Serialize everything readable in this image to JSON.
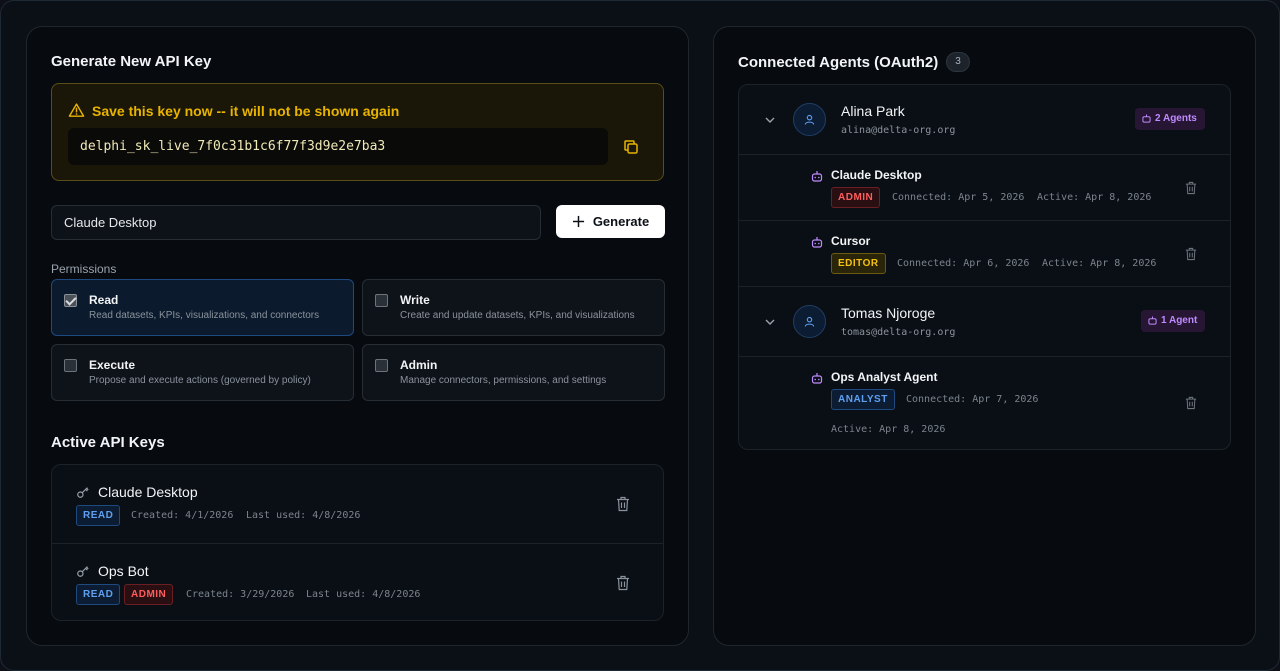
{
  "generate": {
    "title": "Generate New API Key",
    "warning": "Save this key now -- it will not be shown again",
    "key_value": "delphi_sk_live_7f0c31b1c6f77f3d9e2e7ba3",
    "name_input_value": "Claude Desktop",
    "generate_label": "Generate",
    "permissions_label": "Permissions",
    "permissions": [
      {
        "title": "Read",
        "desc": "Read datasets, KPIs, visualizations, and connectors",
        "checked": true
      },
      {
        "title": "Write",
        "desc": "Create and update datasets, KPIs, and visualizations",
        "checked": false
      },
      {
        "title": "Execute",
        "desc": "Propose and execute actions (governed by policy)",
        "checked": false
      },
      {
        "title": "Admin",
        "desc": "Manage connectors, permissions, and settings",
        "checked": false
      }
    ]
  },
  "active_keys": {
    "title": "Active API Keys",
    "keys": [
      {
        "name": "Claude Desktop",
        "badges": [
          "READ"
        ],
        "created": "Created: 4/1/2026",
        "last_used": "Last used: 4/8/2026"
      },
      {
        "name": "Ops Bot",
        "badges": [
          "READ",
          "ADMIN"
        ],
        "created": "Created: 3/29/2026",
        "last_used": "Last used: 4/8/2026"
      }
    ]
  },
  "agents": {
    "title": "Connected Agents (OAuth2)",
    "count": "3",
    "users": [
      {
        "name": "Alina Park",
        "email": "alina@delta-org.org",
        "agent_count": "2 Agents",
        "agents": [
          {
            "name": "Claude Desktop",
            "role": "ADMIN",
            "connected": "Connected: Apr 5, 2026",
            "active": "Active: Apr 8, 2026"
          },
          {
            "name": "Cursor",
            "role": "EDITOR",
            "connected": "Connected: Apr 6, 2026",
            "active": "Active: Apr 8, 2026"
          }
        ]
      },
      {
        "name": "Tomas Njoroge",
        "email": "tomas@delta-org.org",
        "agent_count": "1 Agent",
        "agents": [
          {
            "name": "Ops Analyst Agent",
            "role": "ANALYST",
            "connected": "Connected: Apr 7, 2026",
            "active": "Active: Apr 8, 2026"
          }
        ]
      }
    ]
  },
  "colors": {
    "warning": "#e8b400",
    "read": "#5fa0f0",
    "admin": "#ff5d5d",
    "editor": "#f3c114",
    "agent_badge": "#c08aff"
  },
  "icons": [
    "warning-icon",
    "copy-icon",
    "plus-icon",
    "key-icon",
    "trash-icon",
    "chevron-down-icon",
    "user-icon",
    "bot-icon"
  ]
}
